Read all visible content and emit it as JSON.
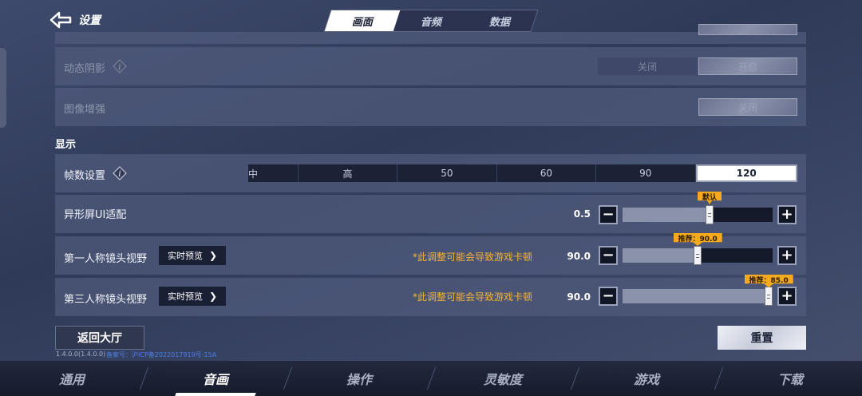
{
  "header": {
    "back_label": "设置",
    "tabs": [
      {
        "label": "画面",
        "active": true
      },
      {
        "label": "音频",
        "active": false
      },
      {
        "label": "数据",
        "active": false
      }
    ]
  },
  "rows": {
    "dynamic_shadow": {
      "label": "动态阴影",
      "off": "关闭",
      "on": "开启",
      "selected": "开启"
    },
    "image_enhance": {
      "label": "图像增强",
      "value": "关闭"
    }
  },
  "display": {
    "section_title": "显示",
    "fps": {
      "label": "帧数设置",
      "options": [
        "中",
        "高",
        "50",
        "60",
        "90",
        "120"
      ],
      "selected": "120"
    },
    "notch_ui": {
      "label": "异形屏UI适配",
      "value": "0.5",
      "tag": "默认",
      "level": 0.58
    },
    "fpp_fov": {
      "label": "第一人称镜头视野",
      "preview": "实时预览",
      "warning": "*此调整可能会导致游戏卡顿",
      "value": "90.0",
      "tag": "推荐：90.0",
      "level": 0.5
    },
    "tpp_fov": {
      "label": "第三人称镜头视野",
      "preview": "实时预览",
      "warning": "*此调整可能会导致游戏卡顿",
      "value": "90.0",
      "tag": "推荐：85.0",
      "level": 1.0
    }
  },
  "footer": {
    "lobby_label": "返回大厅",
    "reset_label": "重置",
    "version": "1.4.0.0(1.4.0.0)",
    "icp": "备案号：沪ICP备2022017919号-15A"
  },
  "bottom_nav": [
    {
      "label": "通用",
      "active": false
    },
    {
      "label": "音画",
      "active": true
    },
    {
      "label": "操作",
      "active": false
    },
    {
      "label": "灵敏度",
      "active": false
    },
    {
      "label": "游戏",
      "active": false
    },
    {
      "label": "下载",
      "active": false
    }
  ],
  "colors": {
    "accent_warning": "#f3b43a",
    "tag_bg": "#f5a91c",
    "link": "#4a7fe0"
  }
}
